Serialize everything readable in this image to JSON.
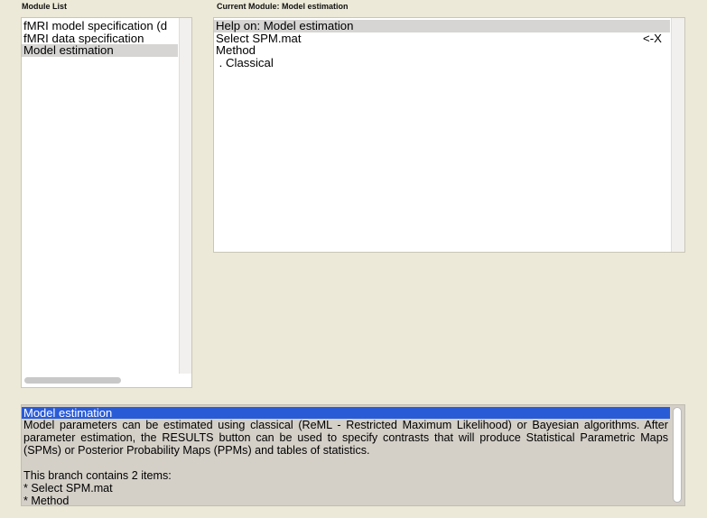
{
  "module_list": {
    "header": "Module List",
    "items": [
      {
        "label": "fMRI model specification (d",
        "selected": false
      },
      {
        "label": "fMRI data specification",
        "selected": false
      },
      {
        "label": "Model estimation",
        "selected": true
      }
    ]
  },
  "current_module": {
    "header": "Current Module: Model estimation",
    "items": [
      {
        "label": "Help on: Model estimation",
        "value": "",
        "selected": true
      },
      {
        "label": "Select SPM.mat",
        "value": "<-X",
        "selected": false
      },
      {
        "label": "Method",
        "value": "",
        "selected": false
      },
      {
        "label": " . Classical",
        "value": "",
        "selected": false
      }
    ]
  },
  "help": {
    "title": "Model estimation",
    "body": "Model parameters can be estimated using classical (ReML - Restricted Maximum Likelihood) or Bayesian algorithms.  After parameter estimation, the RESULTS button can be used to specify contrasts that will produce Statistical Parametric Maps (SPMs) or Posterior Probability Maps (PPMs) and tables of statistics.",
    "branch_text": "This branch contains 2 items:",
    "items": [
      "* Select SPM.mat",
      "* Method"
    ]
  },
  "colors": {
    "background": "#ece9d8",
    "selection_gray": "#d6d5d4",
    "help_title_blue": "#2a5bd7",
    "help_bg": "#d4d0c8"
  }
}
